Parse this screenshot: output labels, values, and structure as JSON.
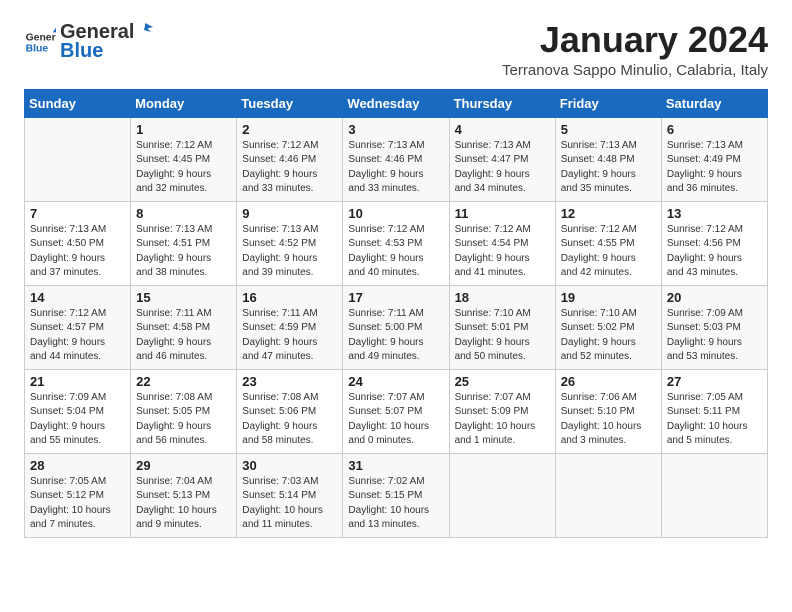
{
  "header": {
    "logo_general": "General",
    "logo_blue": "Blue",
    "month_title": "January 2024",
    "location": "Terranova Sappo Minulio, Calabria, Italy"
  },
  "days_of_week": [
    "Sunday",
    "Monday",
    "Tuesday",
    "Wednesday",
    "Thursday",
    "Friday",
    "Saturday"
  ],
  "weeks": [
    [
      {
        "day": "",
        "info": ""
      },
      {
        "day": "1",
        "info": "Sunrise: 7:12 AM\nSunset: 4:45 PM\nDaylight: 9 hours\nand 32 minutes."
      },
      {
        "day": "2",
        "info": "Sunrise: 7:12 AM\nSunset: 4:46 PM\nDaylight: 9 hours\nand 33 minutes."
      },
      {
        "day": "3",
        "info": "Sunrise: 7:13 AM\nSunset: 4:46 PM\nDaylight: 9 hours\nand 33 minutes."
      },
      {
        "day": "4",
        "info": "Sunrise: 7:13 AM\nSunset: 4:47 PM\nDaylight: 9 hours\nand 34 minutes."
      },
      {
        "day": "5",
        "info": "Sunrise: 7:13 AM\nSunset: 4:48 PM\nDaylight: 9 hours\nand 35 minutes."
      },
      {
        "day": "6",
        "info": "Sunrise: 7:13 AM\nSunset: 4:49 PM\nDaylight: 9 hours\nand 36 minutes."
      }
    ],
    [
      {
        "day": "7",
        "info": "Sunrise: 7:13 AM\nSunset: 4:50 PM\nDaylight: 9 hours\nand 37 minutes."
      },
      {
        "day": "8",
        "info": "Sunrise: 7:13 AM\nSunset: 4:51 PM\nDaylight: 9 hours\nand 38 minutes."
      },
      {
        "day": "9",
        "info": "Sunrise: 7:13 AM\nSunset: 4:52 PM\nDaylight: 9 hours\nand 39 minutes."
      },
      {
        "day": "10",
        "info": "Sunrise: 7:12 AM\nSunset: 4:53 PM\nDaylight: 9 hours\nand 40 minutes."
      },
      {
        "day": "11",
        "info": "Sunrise: 7:12 AM\nSunset: 4:54 PM\nDaylight: 9 hours\nand 41 minutes."
      },
      {
        "day": "12",
        "info": "Sunrise: 7:12 AM\nSunset: 4:55 PM\nDaylight: 9 hours\nand 42 minutes."
      },
      {
        "day": "13",
        "info": "Sunrise: 7:12 AM\nSunset: 4:56 PM\nDaylight: 9 hours\nand 43 minutes."
      }
    ],
    [
      {
        "day": "14",
        "info": "Sunrise: 7:12 AM\nSunset: 4:57 PM\nDaylight: 9 hours\nand 44 minutes."
      },
      {
        "day": "15",
        "info": "Sunrise: 7:11 AM\nSunset: 4:58 PM\nDaylight: 9 hours\nand 46 minutes."
      },
      {
        "day": "16",
        "info": "Sunrise: 7:11 AM\nSunset: 4:59 PM\nDaylight: 9 hours\nand 47 minutes."
      },
      {
        "day": "17",
        "info": "Sunrise: 7:11 AM\nSunset: 5:00 PM\nDaylight: 9 hours\nand 49 minutes."
      },
      {
        "day": "18",
        "info": "Sunrise: 7:10 AM\nSunset: 5:01 PM\nDaylight: 9 hours\nand 50 minutes."
      },
      {
        "day": "19",
        "info": "Sunrise: 7:10 AM\nSunset: 5:02 PM\nDaylight: 9 hours\nand 52 minutes."
      },
      {
        "day": "20",
        "info": "Sunrise: 7:09 AM\nSunset: 5:03 PM\nDaylight: 9 hours\nand 53 minutes."
      }
    ],
    [
      {
        "day": "21",
        "info": "Sunrise: 7:09 AM\nSunset: 5:04 PM\nDaylight: 9 hours\nand 55 minutes."
      },
      {
        "day": "22",
        "info": "Sunrise: 7:08 AM\nSunset: 5:05 PM\nDaylight: 9 hours\nand 56 minutes."
      },
      {
        "day": "23",
        "info": "Sunrise: 7:08 AM\nSunset: 5:06 PM\nDaylight: 9 hours\nand 58 minutes."
      },
      {
        "day": "24",
        "info": "Sunrise: 7:07 AM\nSunset: 5:07 PM\nDaylight: 10 hours\nand 0 minutes."
      },
      {
        "day": "25",
        "info": "Sunrise: 7:07 AM\nSunset: 5:09 PM\nDaylight: 10 hours\nand 1 minute."
      },
      {
        "day": "26",
        "info": "Sunrise: 7:06 AM\nSunset: 5:10 PM\nDaylight: 10 hours\nand 3 minutes."
      },
      {
        "day": "27",
        "info": "Sunrise: 7:05 AM\nSunset: 5:11 PM\nDaylight: 10 hours\nand 5 minutes."
      }
    ],
    [
      {
        "day": "28",
        "info": "Sunrise: 7:05 AM\nSunset: 5:12 PM\nDaylight: 10 hours\nand 7 minutes."
      },
      {
        "day": "29",
        "info": "Sunrise: 7:04 AM\nSunset: 5:13 PM\nDaylight: 10 hours\nand 9 minutes."
      },
      {
        "day": "30",
        "info": "Sunrise: 7:03 AM\nSunset: 5:14 PM\nDaylight: 10 hours\nand 11 minutes."
      },
      {
        "day": "31",
        "info": "Sunrise: 7:02 AM\nSunset: 5:15 PM\nDaylight: 10 hours\nand 13 minutes."
      },
      {
        "day": "",
        "info": ""
      },
      {
        "day": "",
        "info": ""
      },
      {
        "day": "",
        "info": ""
      }
    ]
  ]
}
